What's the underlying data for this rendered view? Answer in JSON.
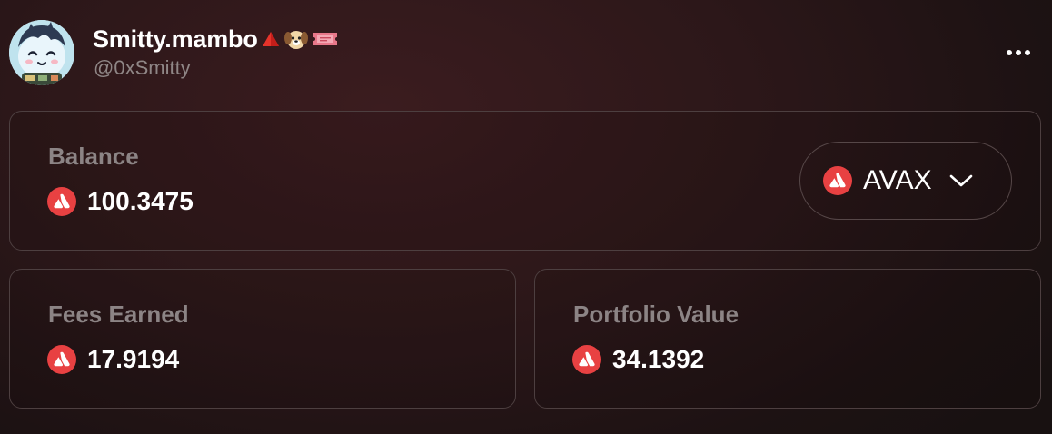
{
  "profile": {
    "display_name": "Smitty.mambo",
    "handle": "@0xSmitty",
    "badges": [
      "red-triangle-icon",
      "dog-face-icon",
      "ticket-icon"
    ]
  },
  "balance": {
    "label": "Balance",
    "value": "100.3475",
    "token": "AVAX"
  },
  "fees": {
    "label": "Fees Earned",
    "value": "17.9194"
  },
  "portfolio": {
    "label": "Portfolio Value",
    "value": "34.1392"
  },
  "colors": {
    "avax_red": "#e84142",
    "label_gray": "#8c8485",
    "border": "#4d3f40"
  }
}
